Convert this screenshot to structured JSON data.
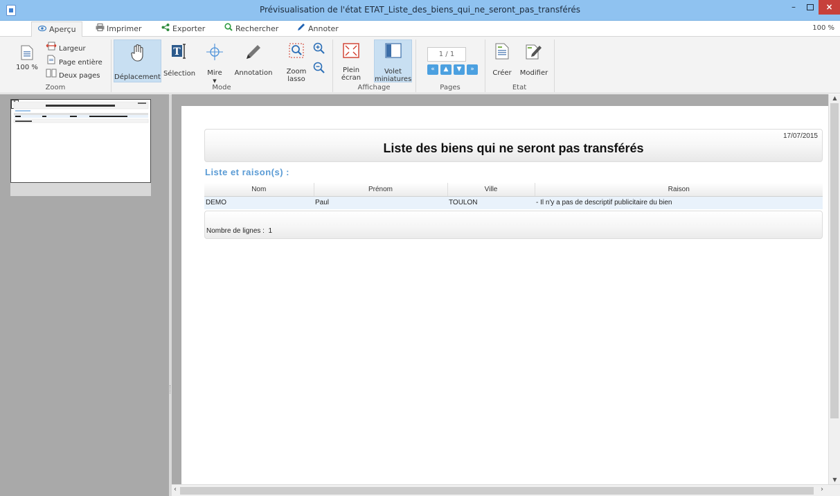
{
  "window": {
    "title": "Prévisualisation de l'état ETAT_Liste_des_biens_qui_ne_seront_pas_transférés",
    "minimize": "–",
    "close": "×"
  },
  "tabs": [
    {
      "label": "Aperçu",
      "icon": "eye-icon"
    },
    {
      "label": "Imprimer",
      "icon": "printer-icon"
    },
    {
      "label": "Exporter",
      "icon": "share-icon"
    },
    {
      "label": "Rechercher",
      "icon": "search-icon"
    },
    {
      "label": "Annoter",
      "icon": "pencil-icon"
    }
  ],
  "zoom_level": "100 %",
  "ribbon": {
    "zoom": {
      "group_label": "Zoom",
      "zoom100": "100 %",
      "largeur": "Largeur",
      "page_entiere": "Page entière",
      "deux_pages": "Deux pages"
    },
    "mode": {
      "group_label": "Mode",
      "deplacement": "Déplacement",
      "selection": "Sélection",
      "mire": "Mire",
      "annotation": "Annotation",
      "zoom_lasso_1": "Zoom",
      "zoom_lasso_2": "lasso"
    },
    "affichage": {
      "group_label": "Affichage",
      "plein_1": "Plein",
      "plein_2": "écran",
      "volet_1": "Volet",
      "volet_2": "miniatures"
    },
    "pages": {
      "group_label": "Pages",
      "indicator": "1 / 1"
    },
    "etat": {
      "group_label": "Etat",
      "creer": "Créer",
      "modifier": "Modifier"
    }
  },
  "thumbnail": {
    "page_number": "1"
  },
  "report": {
    "date": "17/07/2015",
    "title": "Liste des biens qui ne seront pas transférés",
    "section": "Liste et raison(s) :",
    "columns": [
      "Nom",
      "Prénom",
      "Ville",
      "Raison"
    ],
    "rows": [
      [
        "DEMO",
        "Paul",
        "TOULON",
        "- Il n'y a pas de descriptif publicitaire du bien"
      ]
    ],
    "footer_label": "Nombre de lignes :",
    "footer_count": "1"
  },
  "colors": {
    "titlebar": "#8fc2f0",
    "close_button": "#c7413b",
    "section_title": "#5a9bd5",
    "row_highlight": "#e9f2fb",
    "active_mode": "#c8dff2"
  }
}
